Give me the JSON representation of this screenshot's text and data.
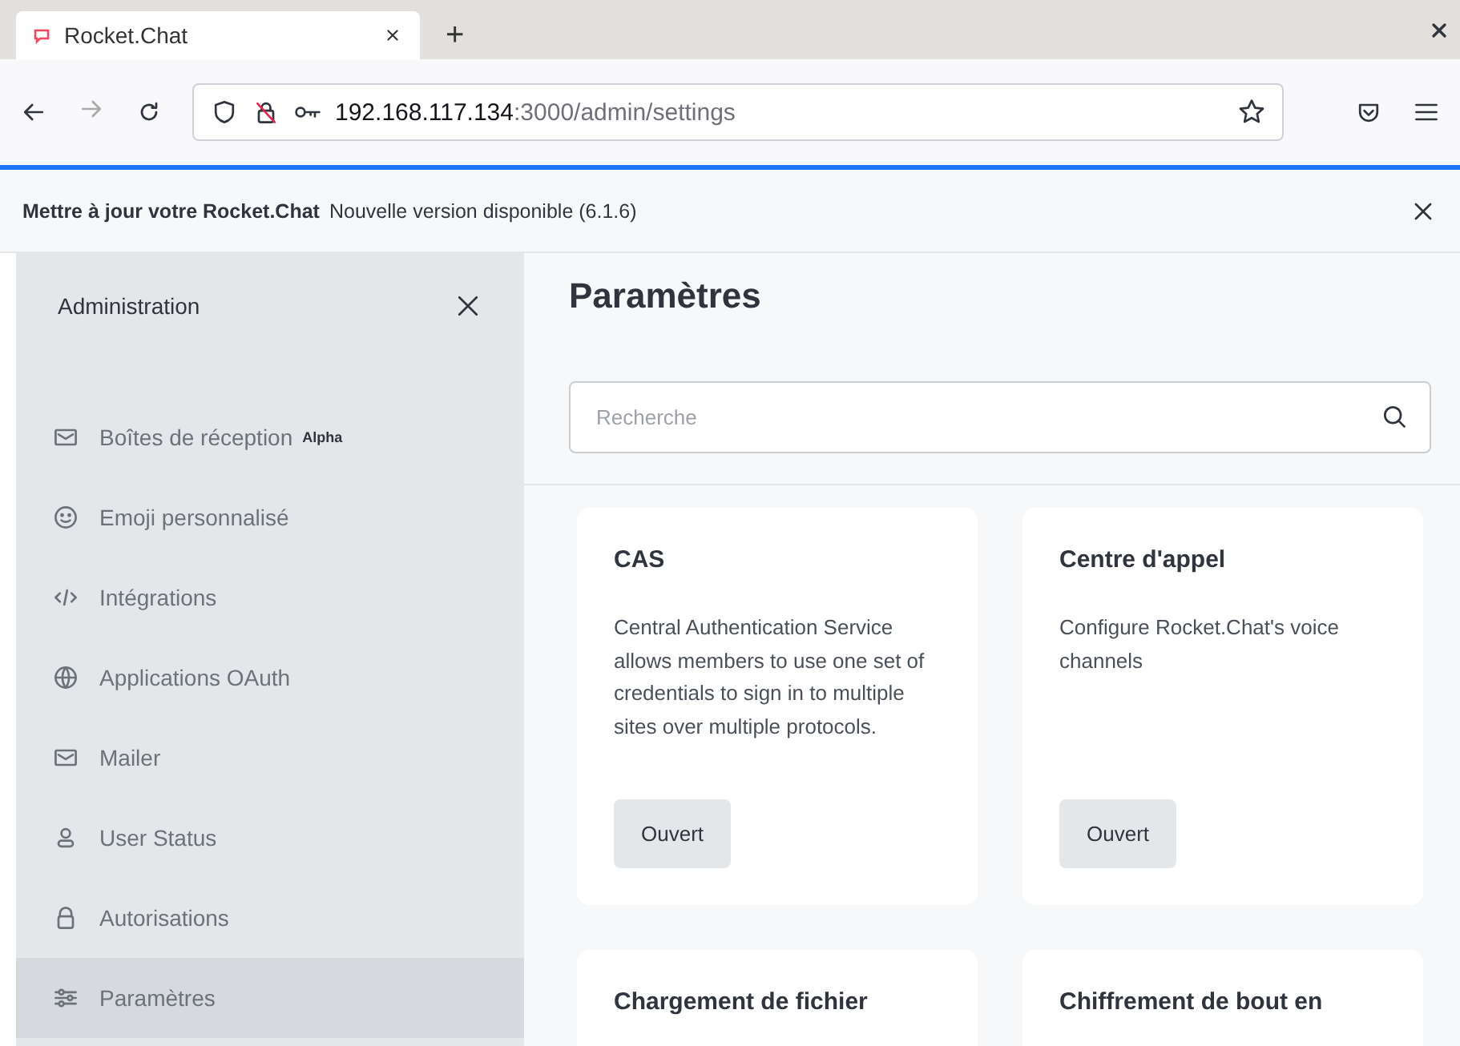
{
  "browser": {
    "tabs": [
      {
        "title": "Rocket.Chat",
        "selected": true
      }
    ],
    "new_tab": "+",
    "address": {
      "host": "192.168.117.134",
      "path": ":3000/admin/settings"
    }
  },
  "banner": {
    "title": "Mettre à jour votre Rocket.Chat",
    "message": "Nouvelle version disponible (6.1.6)"
  },
  "sidebar": {
    "title": "Administration",
    "items": [
      {
        "label": "Boîtes de réception",
        "badge": "Alpha",
        "kind": "mail",
        "selected": false
      },
      {
        "label": "Emoji personnalisé",
        "kind": "smile",
        "selected": false
      },
      {
        "label": "Intégrations",
        "kind": "code",
        "selected": false
      },
      {
        "label": "Applications OAuth",
        "kind": "globe",
        "selected": false
      },
      {
        "label": "Mailer",
        "kind": "mail",
        "selected": false
      },
      {
        "label": "User Status",
        "kind": "user",
        "selected": false
      },
      {
        "label": "Autorisations",
        "kind": "lock",
        "selected": false
      },
      {
        "label": "Paramètres",
        "kind": "sliders",
        "selected": true
      }
    ]
  },
  "main": {
    "title": "Paramètres",
    "search": {
      "placeholder": "Recherche"
    },
    "cards": [
      {
        "title": "CAS",
        "description": "Central Authentication Service allows members to use one set of credentials to sign in to multiple sites over multiple protocols.",
        "button": "Ouvert"
      },
      {
        "title": "Centre d'appel",
        "description": "Configure Rocket.Chat's voice channels",
        "button": "Ouvert"
      },
      {
        "title": "Chargement de fichier"
      },
      {
        "title": "Chiffrement de bout en"
      }
    ]
  }
}
